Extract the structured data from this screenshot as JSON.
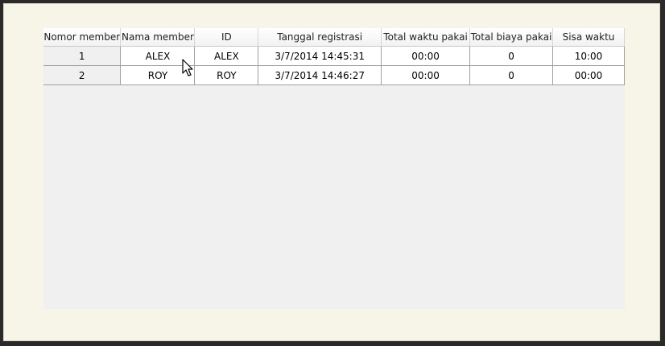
{
  "table": {
    "columns": [
      "Nomor member",
      "Nama member",
      "ID",
      "Tanggal registrasi",
      "Total waktu pakai",
      "Total biaya pakai",
      "Sisa waktu"
    ],
    "rows": [
      [
        "1",
        "ALEX",
        "ALEX",
        "3/7/2014 14:45:31",
        "00:00",
        "0",
        "10:00"
      ],
      [
        "2",
        "ROY",
        "ROY",
        "3/7/2014 14:46:27",
        "00:00",
        "0",
        "00:00"
      ]
    ]
  },
  "icons": {
    "cursor": "mouse-pointer-icon"
  }
}
